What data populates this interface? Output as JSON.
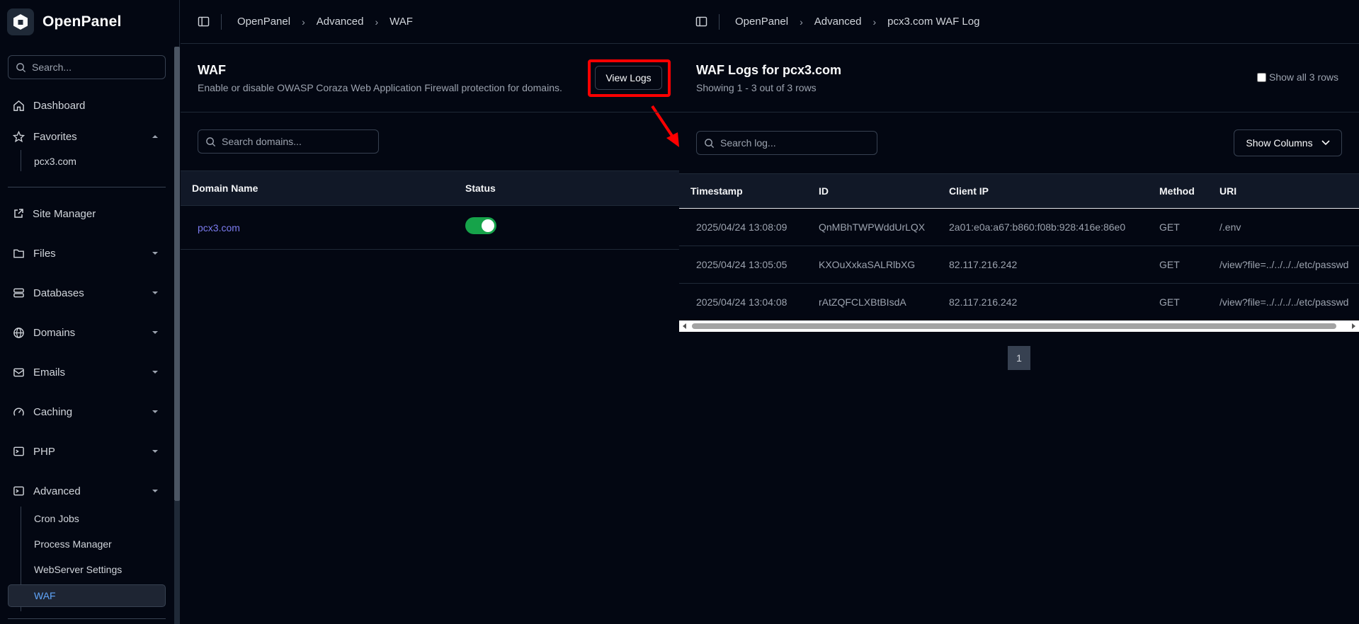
{
  "app": {
    "name": "OpenPanel"
  },
  "sidebar": {
    "search_placeholder": "Search...",
    "items": [
      {
        "label": "Dashboard",
        "icon": "home-icon"
      },
      {
        "label": "Favorites",
        "icon": "star-icon"
      },
      {
        "label": "Site Manager",
        "icon": "external-link-icon"
      },
      {
        "label": "Files",
        "icon": "folder-icon"
      },
      {
        "label": "Databases",
        "icon": "database-icon"
      },
      {
        "label": "Domains",
        "icon": "globe-icon"
      },
      {
        "label": "Emails",
        "icon": "mail-icon"
      },
      {
        "label": "Caching",
        "icon": "gauge-icon"
      },
      {
        "label": "PHP",
        "icon": "terminal-icon"
      },
      {
        "label": "Advanced",
        "icon": "terminal-icon"
      }
    ],
    "favorites": [
      "pcx3.com"
    ],
    "advanced_sub": [
      "Cron Jobs",
      "Process Manager",
      "WebServer Settings",
      "WAF"
    ]
  },
  "left_panel": {
    "breadcrumb": [
      "OpenPanel",
      "Advanced",
      "WAF"
    ],
    "title": "WAF",
    "subtitle": "Enable or disable OWASP Coraza Web Application Firewall protection for domains.",
    "view_logs_label": "View Logs",
    "search_placeholder": "Search domains...",
    "columns": {
      "domain": "Domain Name",
      "status": "Status"
    },
    "rows": [
      {
        "domain": "pcx3.com",
        "enabled": true
      }
    ]
  },
  "right_panel": {
    "breadcrumb": [
      "OpenPanel",
      "Advanced",
      "pcx3.com WAF Log"
    ],
    "title": "WAF Logs for pcx3.com",
    "subtitle": "Showing 1 - 3 out of 3 rows",
    "show_all_label": "Show all 3 rows",
    "search_placeholder": "Search log...",
    "show_columns_label": "Show Columns",
    "columns": {
      "timestamp": "Timestamp",
      "id": "ID",
      "client_ip": "Client IP",
      "method": "Method",
      "uri": "URI"
    },
    "rows": [
      {
        "timestamp": "2025/04/24 13:08:09",
        "id": "QnMBhTWPWddUrLQX",
        "client_ip": "2a01:e0a:a67:b860:f08b:928:416e:86e0",
        "method": "GET",
        "uri": "/.env"
      },
      {
        "timestamp": "2025/04/24 13:05:05",
        "id": "KXOuXxkaSALRlbXG",
        "client_ip": "82.117.216.242",
        "method": "GET",
        "uri": "/view?file=../../../../etc/passwd"
      },
      {
        "timestamp": "2025/04/24 13:04:08",
        "id": "rAtZQFCLXBtBIsdA",
        "client_ip": "82.117.216.242",
        "method": "GET",
        "uri": "/view?file=../../../../etc/passwd"
      }
    ],
    "page": "1"
  },
  "colors": {
    "accent": "#60a5fa",
    "link": "#7c7cf0",
    "toggle_on": "#16a34a",
    "highlight": "#ff0000"
  }
}
